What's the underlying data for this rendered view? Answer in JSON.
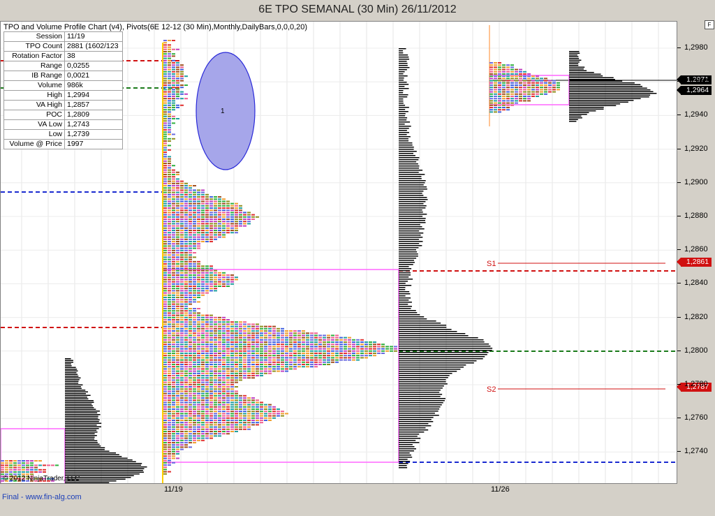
{
  "window_title": "6E TPO SEMANAL (30 Min)  26/11/2012",
  "indicator_caption": "TPO and Volume Profile Chart (v4), Pivots(6E 12-12 (30 Min),Monthly,DailyBars,0,0,0,20)",
  "stats": [
    {
      "label": "Session",
      "value": "11/19"
    },
    {
      "label": "TPO Count",
      "value": "2881 (1602/123"
    },
    {
      "label": "Rotation Factor",
      "value": "38"
    },
    {
      "label": "Range",
      "value": "0,0255"
    },
    {
      "label": "IB Range",
      "value": "0,0021"
    },
    {
      "label": "Volume",
      "value": "986k"
    },
    {
      "label": "High",
      "value": "1,2994"
    },
    {
      "label": "VA High",
      "value": "1,2857"
    },
    {
      "label": "POC",
      "value": "1,2809"
    },
    {
      "label": "VA Low",
      "value": "1,2743"
    },
    {
      "label": "Low",
      "value": "1,2739"
    },
    {
      "label": "Volume @ Price",
      "value": "1997"
    }
  ],
  "y_axis_ticks": [
    "1,2980",
    "1,2960",
    "1,2940",
    "1,2920",
    "1,2900",
    "1,2880",
    "1,2860",
    "1,2840",
    "1,2820",
    "1,2800",
    "1,2780",
    "1,2760",
    "1,2740"
  ],
  "price_badges": {
    "p2971": "1,2971",
    "p2964": "1,2964",
    "p2861": "1,2861",
    "p2787": "1,2787"
  },
  "x_labels": {
    "first": "11/19",
    "second": "11/26"
  },
  "pivots": {
    "s1": "S1",
    "s2": "S2"
  },
  "ellipse_label": "1",
  "copyright": "© 2012 NinjaTrader, LLC",
  "footer_link": "Final - www.fin-alg.com",
  "f_button": "F",
  "colors": {
    "pivot_red": "#d01010",
    "pivot_green": "#1a7a1a",
    "pivot_blue": "#1a2ad0",
    "value_area": "#ff66ff",
    "ellipse_fill": "#a6a6ea",
    "ellipse_stroke": "#2a2ad8"
  }
}
